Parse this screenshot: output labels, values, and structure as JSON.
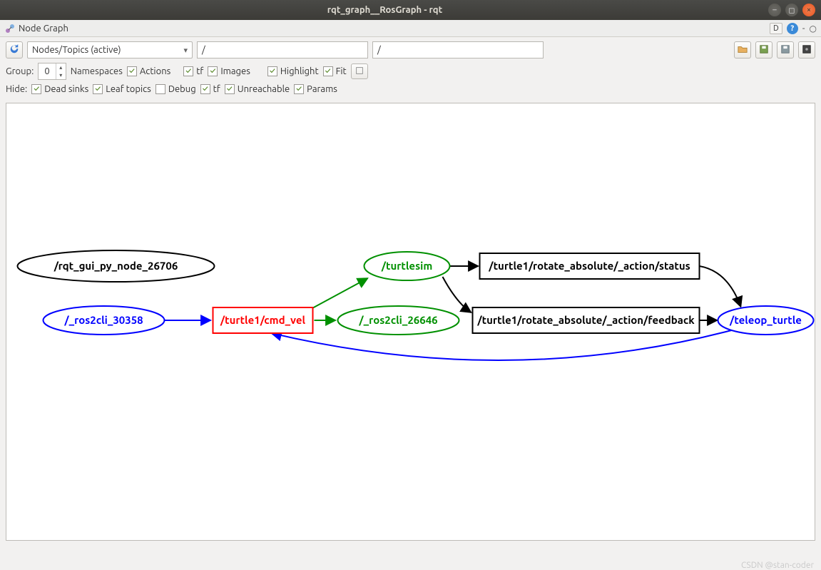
{
  "window": {
    "title": "rqt_graph__RosGraph - rqt"
  },
  "plugin": {
    "title": "Node Graph",
    "d_btn": "D"
  },
  "toolbar1": {
    "view_mode": "Nodes/Topics (active)",
    "filter1": "/",
    "filter2": "/"
  },
  "toolbar2": {
    "group_label": "Group:",
    "group_value": "0",
    "namespaces": "Namespaces",
    "actions": "Actions",
    "tf1": "tf",
    "images": "Images",
    "highlight": "Highlight",
    "fit": "Fit"
  },
  "toolbar3": {
    "hide_label": "Hide:",
    "dead_sinks": "Dead sinks",
    "leaf_topics": "Leaf topics",
    "debug": "Debug",
    "tf2": "tf",
    "unreachable": "Unreachable",
    "params": "Params"
  },
  "graph": {
    "nodes": {
      "rqt_gui": {
        "label": "/rqt_gui_py_node_26706"
      },
      "ros2cli1": {
        "label": "/_ros2cli_30358"
      },
      "turtlesim": {
        "label": "/turtlesim"
      },
      "ros2cli2": {
        "label": "/_ros2cli_26646"
      },
      "teleop": {
        "label": "/teleop_turtle"
      }
    },
    "topics": {
      "cmd_vel": {
        "label": "/turtle1/cmd_vel"
      },
      "status": {
        "label": "/turtle1/rotate_absolute/_action/status"
      },
      "feedback": {
        "label": "/turtle1/rotate_absolute/_action/feedback"
      }
    }
  },
  "watermark": "CSDN @stan-coder"
}
